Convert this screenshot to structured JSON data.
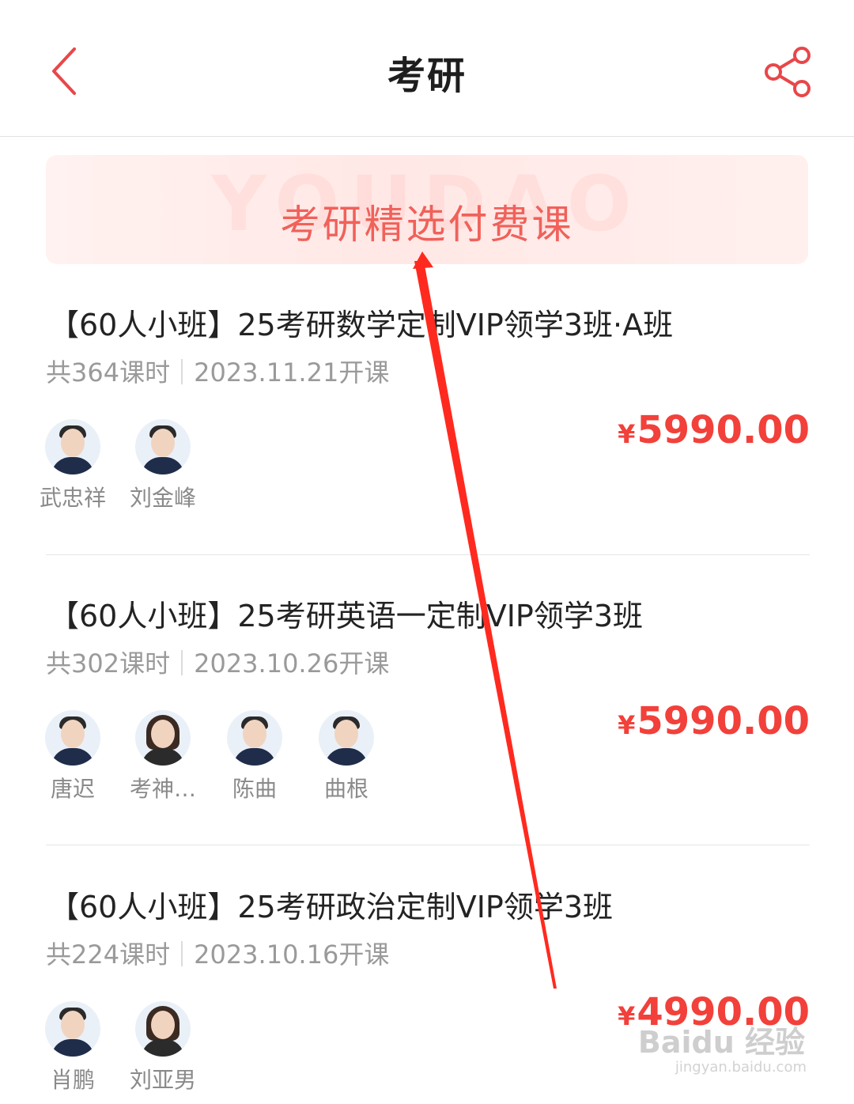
{
  "nav": {
    "title": "考研"
  },
  "banner": {
    "label": "考研精选付费课",
    "watermark": "YOUDAO"
  },
  "courses": [
    {
      "title": "【60人小班】25考研数学定制VIP领学3班·A班",
      "hours": "共364课时",
      "start": "2023.11.21开课",
      "price_symbol": "¥",
      "price": "5990.00",
      "teachers": [
        "武忠祥",
        "刘金峰"
      ]
    },
    {
      "title": "【60人小班】25考研英语一定制VIP领学3班",
      "hours": "共302课时",
      "start": "2023.10.26开课",
      "price_symbol": "¥",
      "price": "5990.00",
      "teachers": [
        "唐迟",
        "考神…",
        "陈曲",
        "曲根"
      ]
    },
    {
      "title": "【60人小班】25考研政治定制VIP领学3班",
      "hours": "共224课时",
      "start": "2023.10.16开课",
      "price_symbol": "¥",
      "price": "4990.00",
      "teachers": [
        "肖鹏",
        "刘亚男"
      ]
    }
  ],
  "watermark": {
    "main": "Baidu 经验",
    "sub": "jingyan.baidu.com"
  },
  "colors": {
    "accent": "#f2403a",
    "banner_text": "#f0615a",
    "annotation_arrow": "#ff2a1f"
  }
}
